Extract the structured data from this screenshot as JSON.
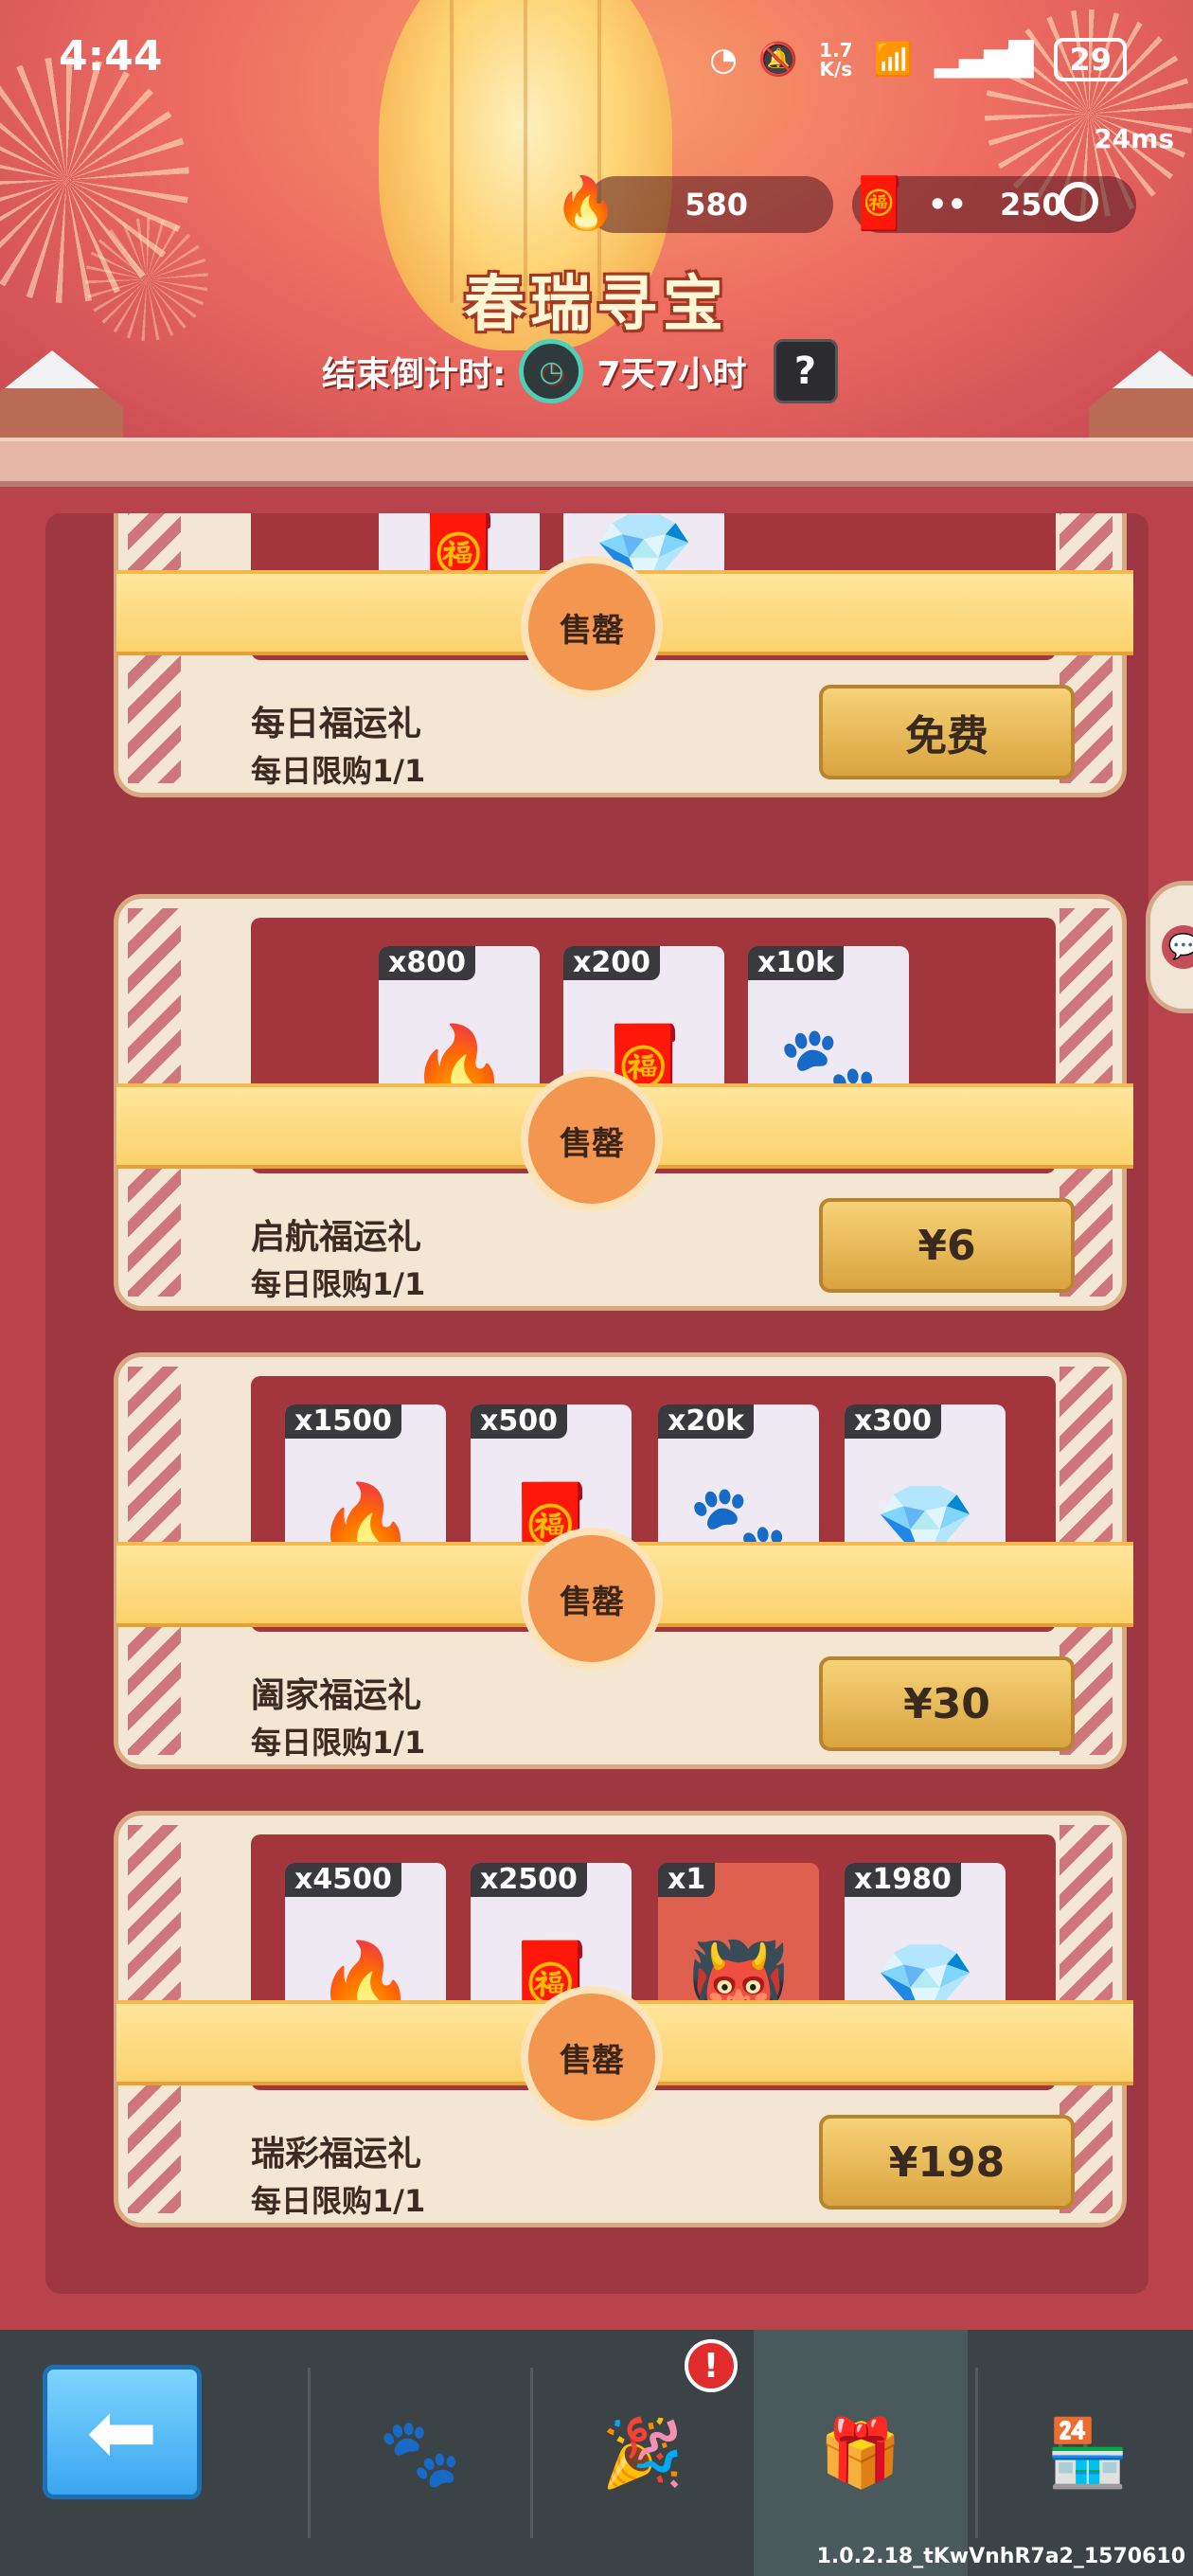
{
  "status_bar": {
    "time": "4:44",
    "net_speed_value": "1.7",
    "net_speed_unit": "K/s",
    "battery": "29"
  },
  "latency": "24ms",
  "currencies": [
    {
      "icon": "torch-icon",
      "value": "580"
    },
    {
      "icon": "stamp-icon",
      "value": "250"
    }
  ],
  "event": {
    "title": "春瑞寻宝",
    "countdown_label": "结束倒计时:",
    "countdown_value": "7天7小时",
    "help_label": "?"
  },
  "sold_out_label": "售罄",
  "gifts": [
    {
      "name": "每日福运礼",
      "limit": "每日限购1/1",
      "price": "免费",
      "items": []
    },
    {
      "name": "启航福运礼",
      "limit": "每日限购1/1",
      "price": "¥6",
      "items": [
        {
          "qty": "x800",
          "icon": "torch-icon"
        },
        {
          "qty": "x200",
          "icon": "stamp-icon"
        },
        {
          "qty": "x10k",
          "icon": "paw-coin-icon"
        }
      ]
    },
    {
      "name": "阖家福运礼",
      "limit": "每日限购1/1",
      "price": "¥30",
      "items": [
        {
          "qty": "x1500",
          "icon": "torch-icon"
        },
        {
          "qty": "x500",
          "icon": "stamp-icon"
        },
        {
          "qty": "x20k",
          "icon": "paw-coin-icon"
        },
        {
          "qty": "x300",
          "icon": "diamond-icon"
        }
      ]
    },
    {
      "name": "瑞彩福运礼",
      "limit": "每日限购1/1",
      "price": "¥198",
      "items": [
        {
          "qty": "x4500",
          "icon": "torch-icon"
        },
        {
          "qty": "x2500",
          "icon": "stamp-icon"
        },
        {
          "qty": "x1",
          "icon": "character-icon"
        },
        {
          "qty": "x1980",
          "icon": "diamond-icon"
        }
      ]
    }
  ],
  "nav": {
    "alert_badge": "!",
    "items": [
      "back-arrow-icon",
      "paw-shield-icon",
      "party-popper-icon",
      "gift-icon",
      "shop-icon"
    ]
  },
  "version": "1.0.2.18_tKwVnhR7a2_1570610",
  "colors": {
    "accent": "#4ec4ad",
    "panel": "#9d3840",
    "banner": "#fbd26e",
    "sold_badge": "#f39650"
  }
}
